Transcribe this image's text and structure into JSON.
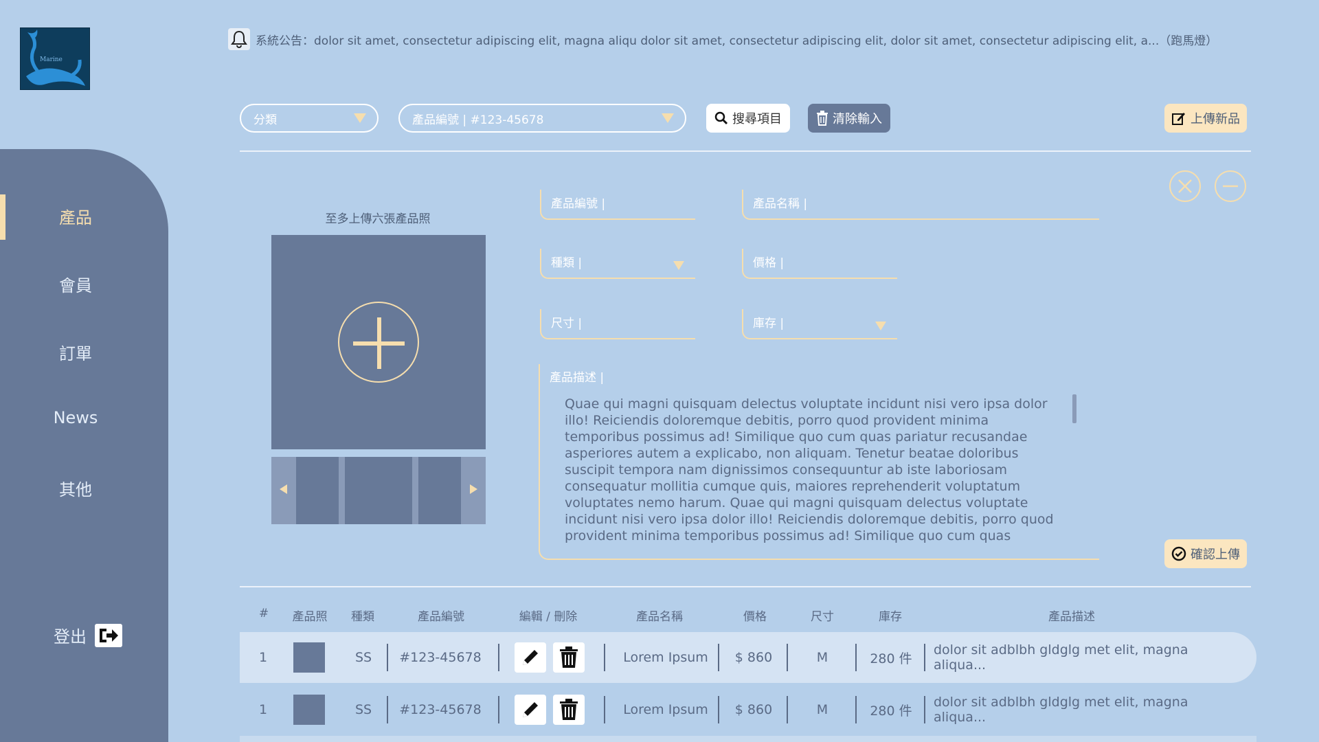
{
  "logo": {
    "text": "Marine"
  },
  "announcement": {
    "icon": "bell-icon",
    "text": "系統公告：dolor sit amet, consectetur adipiscing elit, magna aliqu dolor sit amet, consectetur adipiscing elit, dolor sit amet, consectetur adipiscing elit, a...（跑馬燈）"
  },
  "sidebar": {
    "items": [
      {
        "label": "產品",
        "active": true
      },
      {
        "label": "會員"
      },
      {
        "label": "訂單"
      },
      {
        "label": "News"
      },
      {
        "label": "其他"
      }
    ],
    "logout_label": "登出"
  },
  "filters": {
    "category": "分類",
    "product_id": "產品編號 | #123-45678",
    "search_label": "搜尋項目",
    "clear_label": "清除輸入",
    "upload_new_label": "上傳新品"
  },
  "form": {
    "upload_caption": "至多上傳六張產品照",
    "product_id_label": "產品編號 |",
    "product_name_label": "產品名稱 |",
    "type_label": "種類 |",
    "price_label": "價格 |",
    "size_label": "尺寸 |",
    "stock_label": "庫存 |",
    "description_label": "產品描述 |",
    "description_text": "Quae qui magni quisquam delectus voluptate incidunt nisi vero ipsa dolor illo! Reiciendis doloremque debitis, porro quod provident minima temporibus possimus ad! Similique quo cum quas pariatur recusandae asperiores autem a explicabo, non aliquam. Tenetur beatae doloribus suscipit tempora nam dignissimos consequuntur ab iste laboriosam consequatur mollitia cumque quis, maiores reprehenderit voluptatum voluptates nemo harum. Quae qui magni quisquam delectus voluptate incidunt nisi vero ipsa dolor illo! Reiciendis doloremque debitis, porro quod provident minima temporibus possimus ad! Similique quo cum quas pariatur recusandae asperiores autem a explicabo, non",
    "confirm_label": "確認上傳"
  },
  "table": {
    "headers": [
      "#",
      "產品照",
      "種類",
      "產品編號",
      "編輯 / 刪除",
      "產品名稱",
      "價格",
      "尺寸",
      "庫存",
      "產品描述"
    ],
    "rows": [
      {
        "num": "1",
        "type": "SS",
        "id": "#123-45678",
        "name": "Lorem Ipsum",
        "price": "$ 860",
        "size": "M",
        "stock": "280 件",
        "desc": "dolor sit adblbh gldglg met elit, magna aliqua..."
      },
      {
        "num": "1",
        "type": "SS",
        "id": "#123-45678",
        "name": "Lorem Ipsum",
        "price": "$ 860",
        "size": "M",
        "stock": "280 件",
        "desc": "dolor sit adblbh gldglg met elit, magna aliqua..."
      }
    ]
  },
  "colors": {
    "background": "#b5cfea",
    "sidebar": "#677998",
    "accent": "#f6deae",
    "button_gold": "#fbe6c0"
  }
}
